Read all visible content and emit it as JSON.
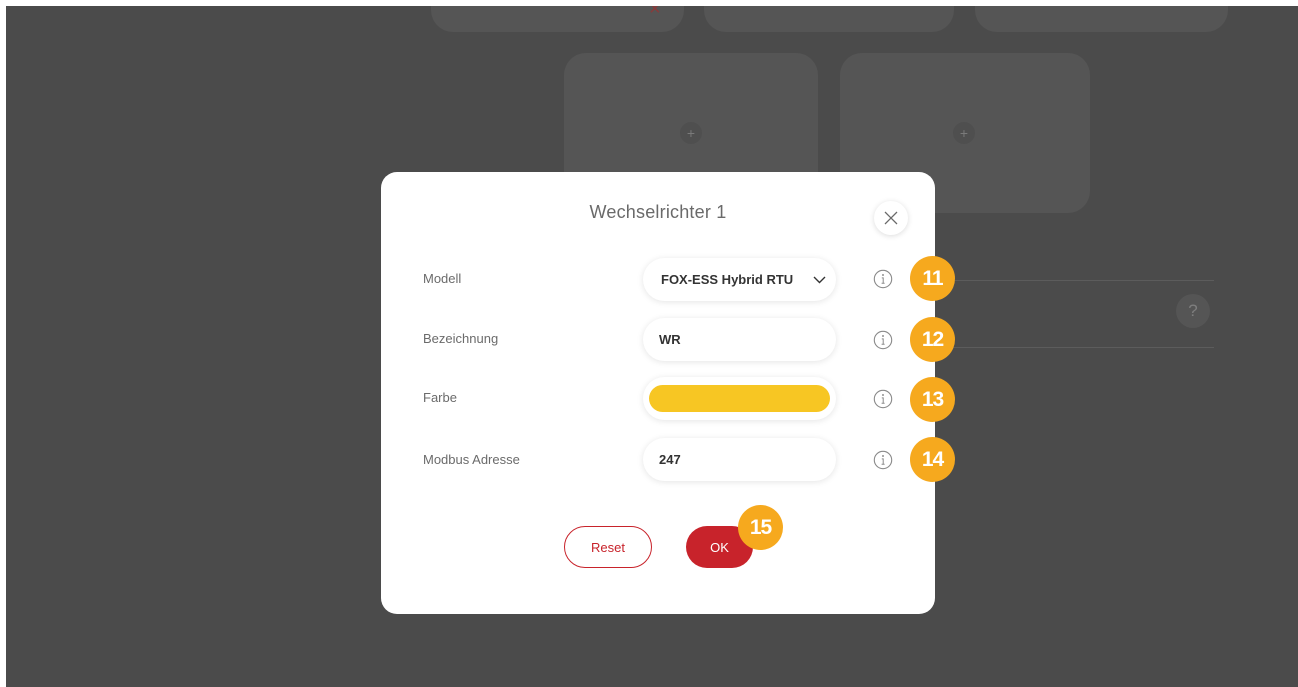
{
  "dialog": {
    "title": "Wechselrichter 1",
    "fields": {
      "model": {
        "label": "Modell",
        "value": "FOX-ESS Hybrid RTU",
        "badge": "11"
      },
      "name": {
        "label": "Bezeichnung",
        "value": "WR",
        "badge": "12"
      },
      "color": {
        "label": "Farbe",
        "value_color": "#f7c623",
        "badge": "13"
      },
      "modbus": {
        "label": "Modbus Adresse",
        "value": "247",
        "badge": "14"
      }
    },
    "reset_label": "Reset",
    "ok_label": "OK",
    "ok_badge": "15"
  },
  "background": {
    "help_glyph": "?",
    "add_glyph": "+",
    "remove_glyph": "×"
  },
  "colors": {
    "accent_red": "#c8232b",
    "badge_orange": "#f6a91e",
    "backdrop": "#4b4b4b"
  },
  "icons": [
    "close-icon",
    "chevron-down-icon",
    "info-icon",
    "plus-icon",
    "help-icon"
  ]
}
